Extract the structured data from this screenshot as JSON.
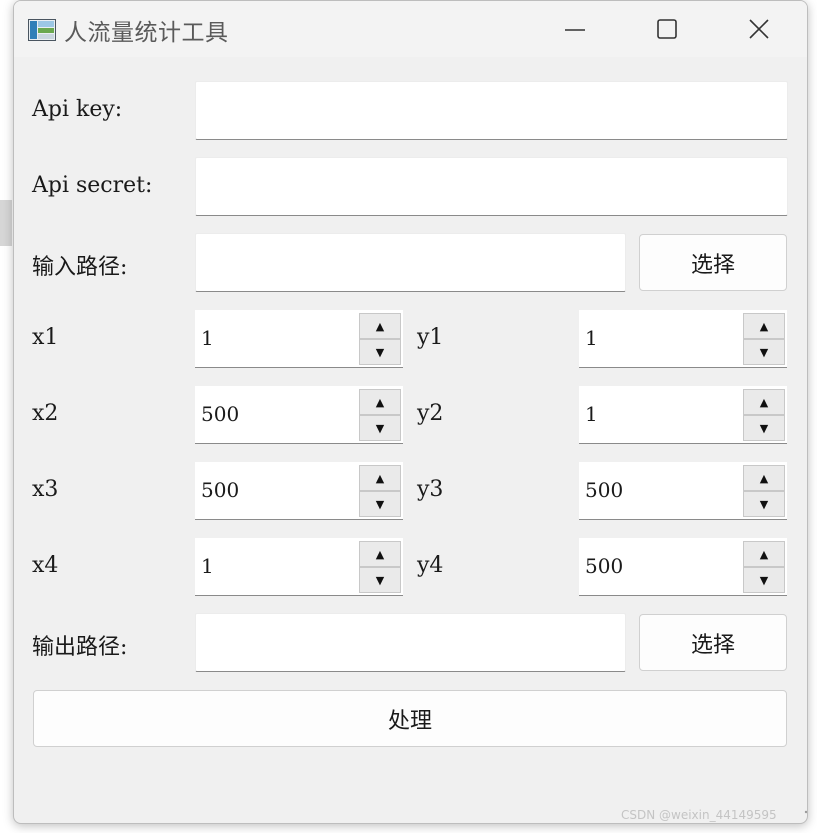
{
  "window": {
    "title": "人流量统计工具",
    "controls": {
      "minimize_icon": "minimize-icon",
      "maximize_icon": "maximize-icon",
      "close_icon": "close-icon"
    }
  },
  "form": {
    "api_key": {
      "label": "Api key:",
      "value": ""
    },
    "api_secret": {
      "label": "Api secret:",
      "value": ""
    },
    "input_path": {
      "label": "输入路径:",
      "value": "",
      "button": "选择"
    },
    "coords": [
      {
        "x_label": "x1",
        "x_value": "1",
        "y_label": "y1",
        "y_value": "1"
      },
      {
        "x_label": "x2",
        "x_value": "500",
        "y_label": "y2",
        "y_value": "1"
      },
      {
        "x_label": "x3",
        "x_value": "500",
        "y_label": "y3",
        "y_value": "500"
      },
      {
        "x_label": "x4",
        "x_value": "1",
        "y_label": "y4",
        "y_value": "500"
      }
    ],
    "output_path": {
      "label": "输出路径:",
      "value": "",
      "button": "选择"
    },
    "process_button": "处理"
  },
  "watermark": "CSDN @weixin_44149595",
  "colors": {
    "window_bg": "#f0f0f0",
    "input_bg": "#ffffff",
    "text": "#1a1a1a"
  }
}
